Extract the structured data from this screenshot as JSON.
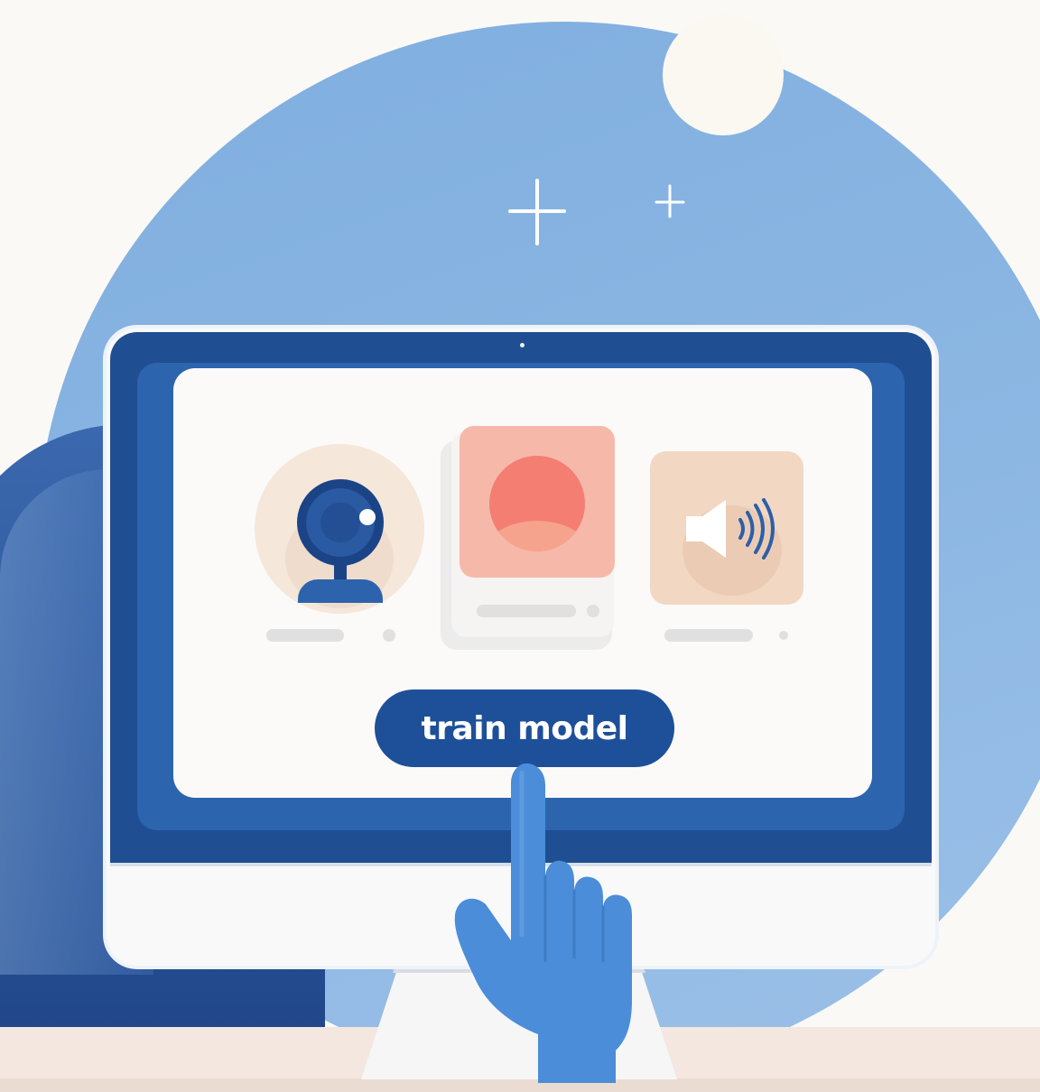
{
  "button": {
    "label": "train model"
  },
  "icons": {
    "webcam": "webcam-icon",
    "image": "image-placeholder-icon",
    "audio": "speaker-icon",
    "hand": "pointing-hand-icon",
    "sparkles": "sparkle-icon"
  },
  "colors": {
    "background": "#FBF9F6",
    "circle": "#8DB7E3",
    "monitor_bezel": "#1F4E93",
    "button": "#1E5099",
    "hand": "#4B8DD8",
    "image_card": "#F6B9A9",
    "audio_card": "#F2D7C2",
    "webcam_card": "#F5E7DA"
  }
}
